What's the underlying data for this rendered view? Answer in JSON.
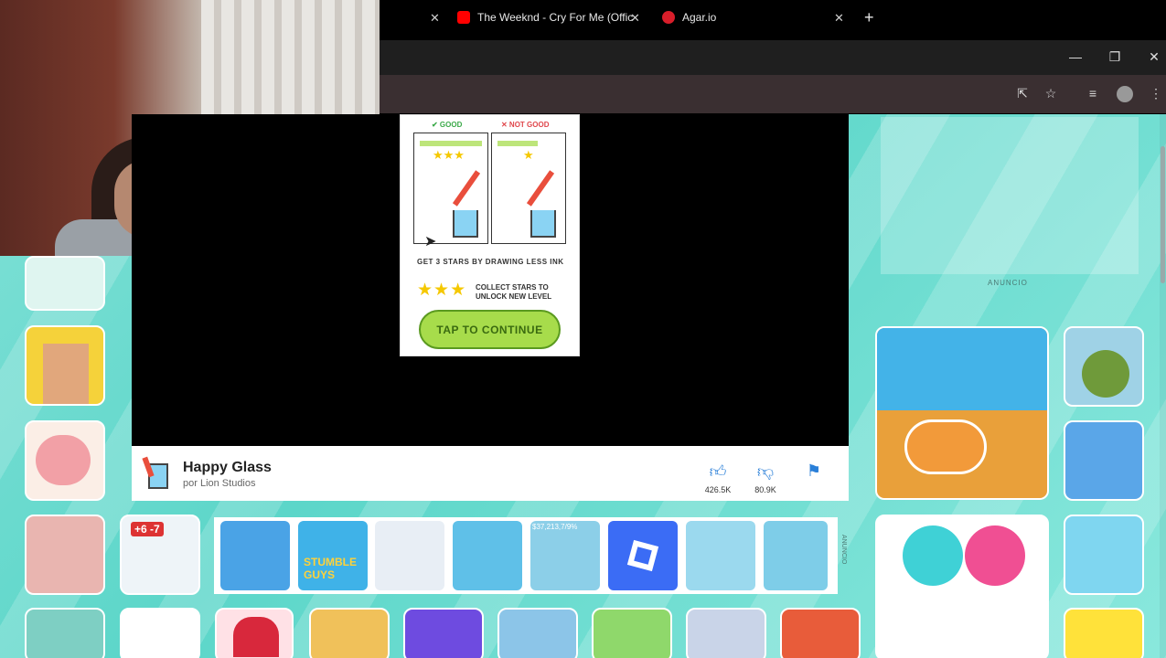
{
  "browser": {
    "tabs": [
      {
        "title": "The Weeknd - Cry For Me (Offic",
        "favicon_color": "#ff0000"
      },
      {
        "title": "Agar.io",
        "favicon_color": "#d81e2a"
      }
    ],
    "new_tab_symbol": "+",
    "close_symbol": "✕",
    "window_controls": {
      "minimize": "—",
      "restore": "❐",
      "close": "✕"
    },
    "toolbar_icons": [
      "install-icon",
      "star-icon",
      "media-icon",
      "profile-icon",
      "menu-icon"
    ]
  },
  "game": {
    "good_label": "✔ GOOD",
    "bad_label": "✕ NOT GOOD",
    "good_stars": "★★★",
    "bad_stars": "★",
    "hint": "GET 3 STARS BY DRAWING LESS INK",
    "stars_row": "★★★",
    "collect_text": "COLLECT STARS TO UNLOCK NEW LEVEL",
    "continue_label": "TAP TO CONTINUE"
  },
  "info": {
    "title": "Happy Glass",
    "subtitle": "por Lion Studios",
    "likes": "426.5K",
    "dislikes": "80.9K"
  },
  "ad_label": "ANUNCIO",
  "strip_ad_label": "ANUNCIO",
  "strip_price": "$37,213,7/9%",
  "tiles": {
    "stumble_text": "STUMBLE GUYS",
    "plus_minus": "+6  -7"
  },
  "colors": {
    "accent_green": "#a7dc4b",
    "page_bg": "#5cd6c9",
    "tab_bar": "#1f1f1f",
    "toolbar": "#3a2f31"
  }
}
